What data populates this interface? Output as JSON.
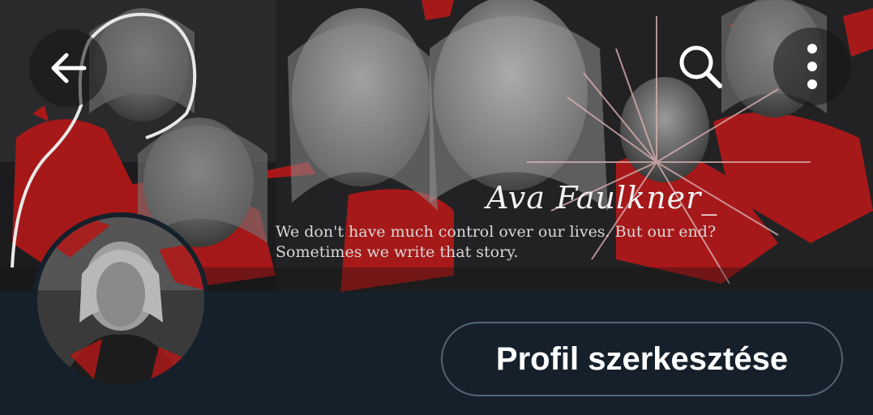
{
  "header": {
    "banner_title": "Ava Faulkner_",
    "banner_quote_line1": "We don't have much control over our lives. But our end?",
    "banner_quote_line2": "Sometimes we write that story."
  },
  "actions": {
    "back_icon": "arrow-left-icon",
    "search_icon": "search-icon",
    "more_icon": "more-vertical-icon",
    "edit_profile_label": "Profil szerkesztése"
  },
  "theme": {
    "background": "#15202b",
    "button_border": "#536471",
    "accent_red": "#c21a1a"
  }
}
